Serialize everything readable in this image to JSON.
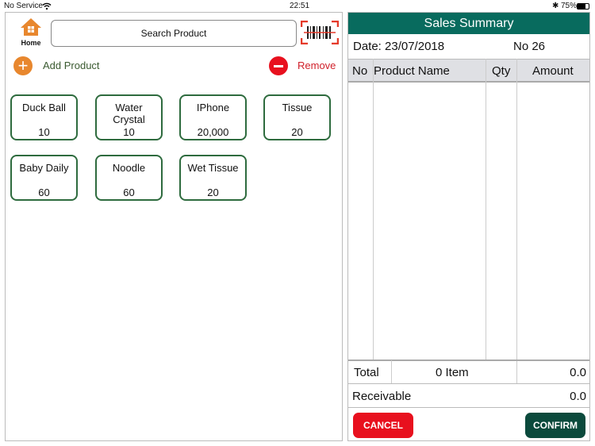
{
  "status_bar": {
    "carrier": "No Service",
    "time": "22:51",
    "battery": "75%"
  },
  "toolbar": {
    "home_label": "Home",
    "search_placeholder": "Search Product",
    "add_label": "Add Product",
    "remove_label": "Remove"
  },
  "products": [
    {
      "name": "Duck Ball",
      "qty": "10"
    },
    {
      "name": "Water Crystal",
      "qty": "10"
    },
    {
      "name": "IPhone",
      "qty": "20,000"
    },
    {
      "name": "Tissue",
      "qty": "20"
    },
    {
      "name": "Baby Daily",
      "qty": "60"
    },
    {
      "name": "Noodle",
      "qty": "60"
    },
    {
      "name": "Wet Tissue",
      "qty": "20"
    }
  ],
  "summary": {
    "title": "Sales Summary",
    "date": "Date: 23/07/2018",
    "number": "No 26",
    "columns": [
      "No",
      "Product Name",
      "Qty",
      "Amount"
    ],
    "total_label": "Total",
    "total_items": "0 Item",
    "total_amount": "0.0",
    "receivable_label": "Receivable",
    "receivable_amount": "0.0",
    "cancel": "CANCEL",
    "confirm": "CONFIRM"
  },
  "colors": {
    "header": "#086b5e",
    "cancel": "#e8101e",
    "confirm": "#0b4a3c",
    "accent": "#e8872e"
  }
}
